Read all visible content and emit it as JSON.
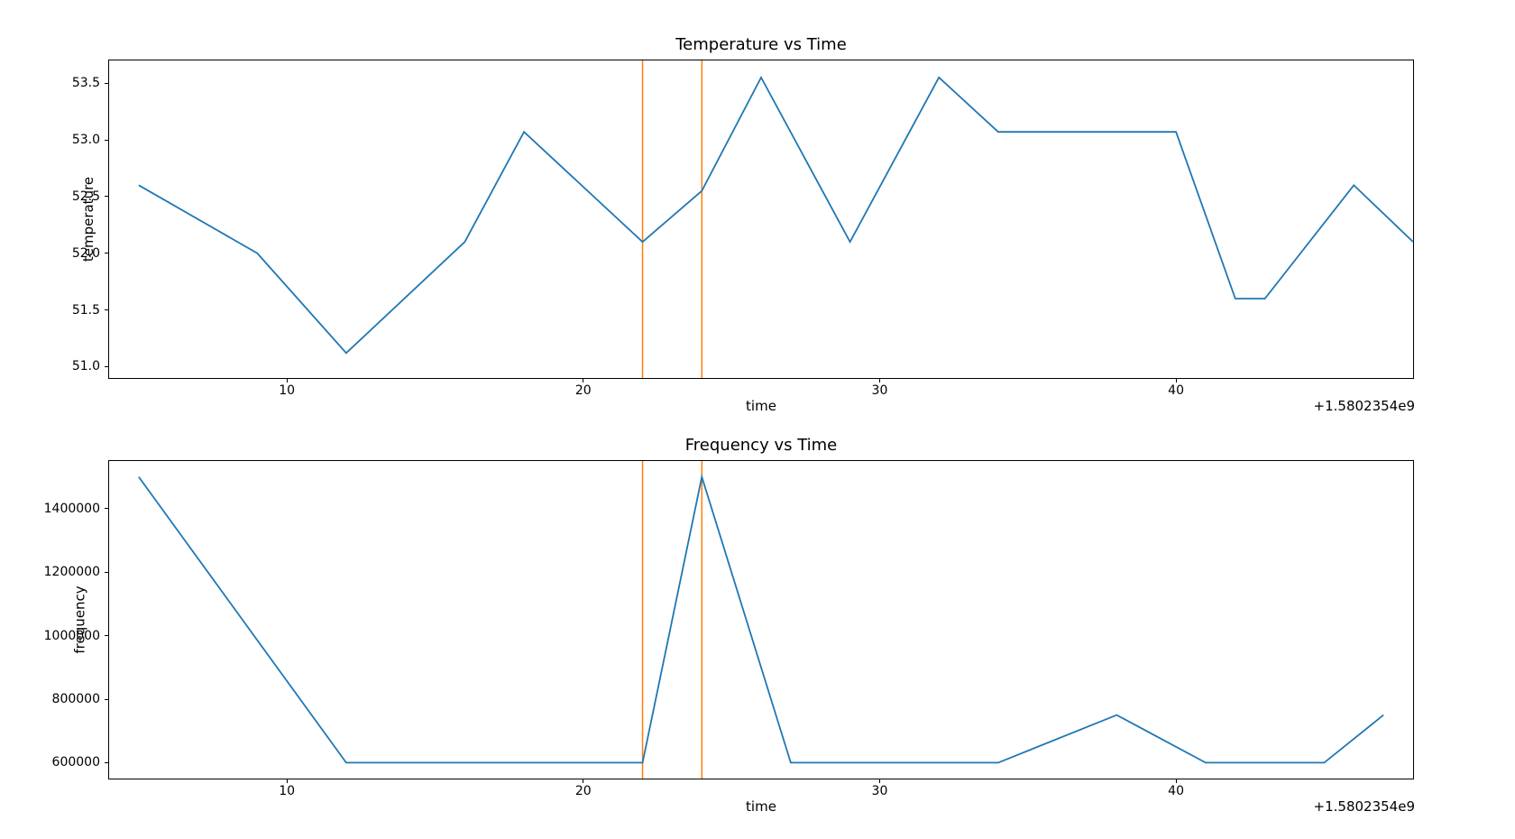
{
  "chart_data": [
    {
      "type": "line",
      "title": "Temperature vs Time",
      "xlabel": "time",
      "ylabel": "temperature",
      "x_offset_text": "+1.5802354e9",
      "x_ticks": [
        10,
        20,
        30,
        40
      ],
      "y_ticks": [
        51.0,
        51.5,
        52.0,
        52.5,
        53.0,
        53.5
      ],
      "xlim": [
        4,
        48
      ],
      "ylim": [
        50.9,
        53.7
      ],
      "series": [
        {
          "name": "temperature",
          "color": "#1f77b4",
          "x": [
            5,
            9,
            12,
            16,
            18,
            22,
            24,
            26,
            29,
            32,
            34,
            40,
            42,
            43,
            46,
            48
          ],
          "y": [
            52.6,
            52.0,
            51.12,
            52.1,
            53.07,
            52.1,
            52.55,
            53.55,
            52.1,
            53.55,
            53.07,
            53.07,
            51.6,
            51.6,
            52.6,
            52.1
          ]
        }
      ],
      "vlines": {
        "color": "#ff7f0e",
        "x": [
          22,
          24
        ]
      }
    },
    {
      "type": "line",
      "title": "Frequency vs Time",
      "xlabel": "time",
      "ylabel": "frequency",
      "x_offset_text": "+1.5802354e9",
      "x_ticks": [
        10,
        20,
        30,
        40
      ],
      "y_ticks": [
        600000,
        800000,
        1000000,
        1200000,
        1400000
      ],
      "xlim": [
        4,
        48
      ],
      "ylim": [
        550000,
        1550000
      ],
      "series": [
        {
          "name": "frequency",
          "color": "#1f77b4",
          "x": [
            5,
            12,
            22,
            24,
            27,
            34,
            38,
            41,
            45,
            47
          ],
          "y": [
            1500000,
            600000,
            600000,
            1500000,
            600000,
            600000,
            750000,
            600000,
            600000,
            750000
          ]
        }
      ],
      "vlines": {
        "color": "#ff7f0e",
        "x": [
          22,
          24
        ]
      }
    }
  ]
}
